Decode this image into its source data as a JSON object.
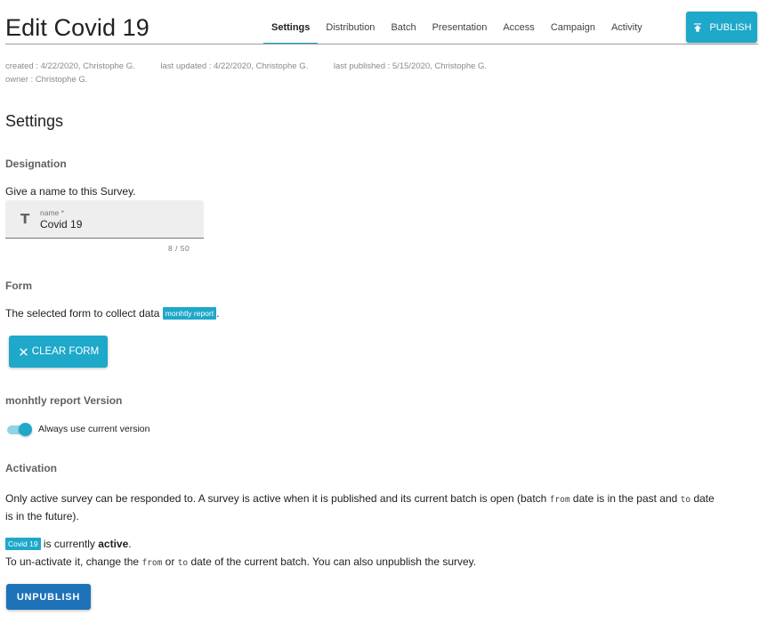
{
  "header": {
    "title": "Edit Covid 19",
    "tabs": [
      {
        "label": "Settings",
        "active": true
      },
      {
        "label": "Distribution",
        "active": false
      },
      {
        "label": "Batch",
        "active": false
      },
      {
        "label": "Presentation",
        "active": false
      },
      {
        "label": "Access",
        "active": false
      },
      {
        "label": "Campaign",
        "active": false
      },
      {
        "label": "Activity",
        "active": false
      }
    ],
    "publish_label": "PUBLISH",
    "publish_icon": "publish-icon"
  },
  "meta": {
    "created": "created : 4/22/2020,  Christophe G.",
    "last_updated": "last updated : 4/22/2020,  Christophe G.",
    "last_published": "last published : 5/15/2020,  Christophe G.",
    "owner": "owner :  Christophe G."
  },
  "settings": {
    "heading": "Settings",
    "designation": {
      "label": "Designation",
      "description": "Give a name to this Survey.",
      "field_icon": "text-format-icon",
      "field_label": "name *",
      "field_value": "Covid 19",
      "counter": "8 / 50"
    },
    "form": {
      "label": "Form",
      "description": "The selected form to collect data",
      "selected_form": "monhtly report",
      "trailing": ".",
      "clear_icon": "close-icon",
      "clear_label": "CLEAR FORM"
    },
    "version": {
      "label": "monhtly report Version",
      "toggle_on": true,
      "toggle_label": "Always use current version"
    },
    "activation": {
      "label": "Activation",
      "para_part1": "Only active survey can be responded to. A survey is active when it is published and its current batch is open (batch ",
      "code_from": "from",
      "para_part2": " date is in the past and ",
      "code_to": "to",
      "para_part3a": " date",
      "para_part3b": "is in the future).",
      "survey_chip": "Covid 19",
      "status_prefix": " is currently ",
      "status_word": "active",
      "status_suffix": ".",
      "howto_part1": "To un-activate it, change the ",
      "howto_from": "from",
      "howto_or": " or ",
      "howto_to": "to",
      "howto_part2": " date of the current batch. You can also unpublish the survey.",
      "unpublish_label": "UNPUBLISH"
    }
  },
  "colors": {
    "accent": "#1ea8c9",
    "unpublish": "#1e72b8",
    "tab_indicator": "#1ea3c2"
  }
}
